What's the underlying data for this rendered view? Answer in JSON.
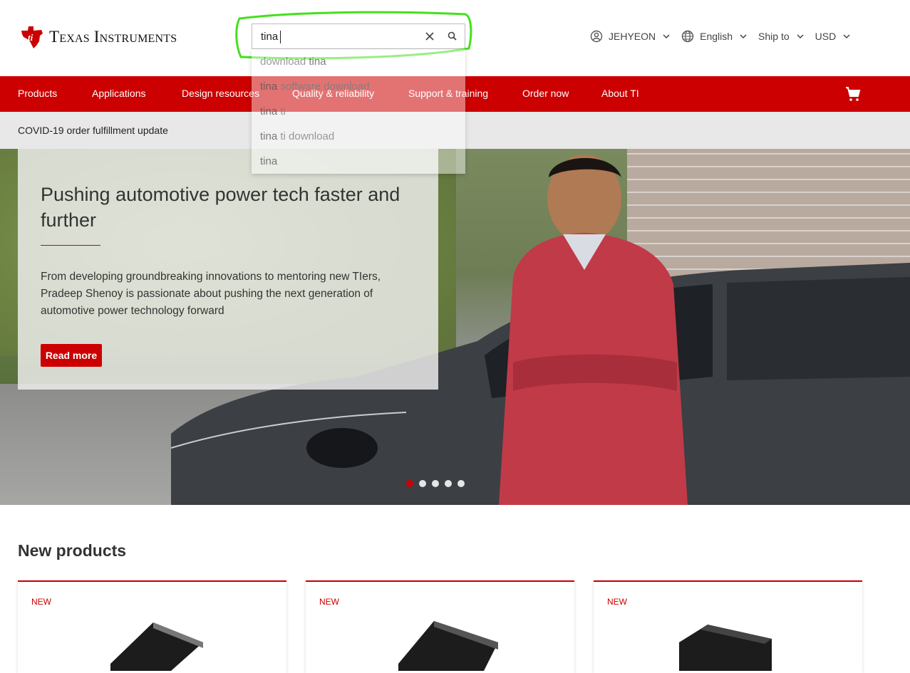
{
  "brand": {
    "name": "Texas Instruments",
    "red": "#cc0000"
  },
  "search": {
    "value": "tina"
  },
  "header_right": {
    "account": "JEHYEON",
    "language": "English",
    "ship_to": "Ship to",
    "currency": "USD"
  },
  "nav": {
    "items": [
      "Products",
      "Applications",
      "Design resources",
      "Quality & reliability",
      "Support & training",
      "Order now",
      "About TI"
    ]
  },
  "covid_link": "COVID-19 order fulfillment update",
  "hero": {
    "title": "Pushing automotive power tech faster and further",
    "body": "From developing groundbreaking innovations to mentoring new TIers, Pradeep Shenoy is passionate about pushing the next generation of automotive power technology forward",
    "cta": "Read more",
    "slides": 5,
    "active_slide": 1
  },
  "suggestions": [
    {
      "pre": "download ",
      "match": "tina",
      "post": ""
    },
    {
      "pre": "",
      "match": "tina",
      "post": " software download"
    },
    {
      "pre": "",
      "match": "tina",
      "post": " ti"
    },
    {
      "pre": "",
      "match": "tina",
      "post": " ti download"
    },
    {
      "pre": "",
      "match": "tina",
      "post": ""
    }
  ],
  "new_products": {
    "title": "New products",
    "badge": "NEW"
  }
}
